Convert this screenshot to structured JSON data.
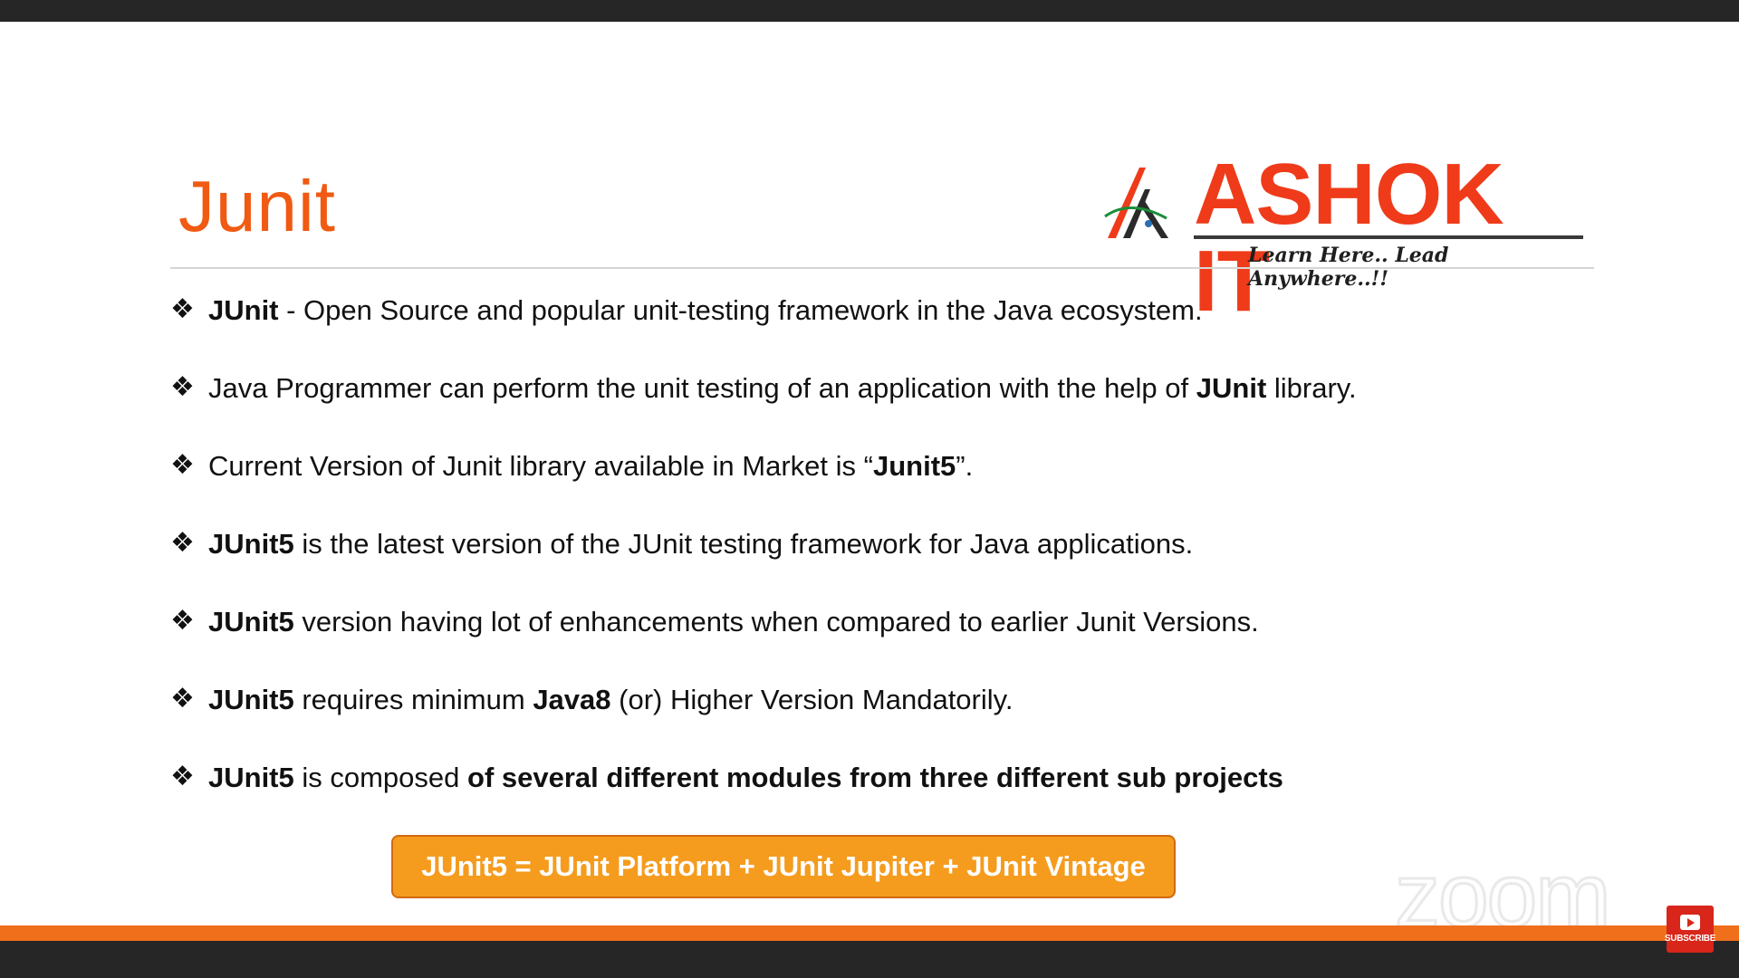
{
  "slide": {
    "title": "Junit",
    "logo": {
      "name": "ASHOK IT",
      "tagline": "Learn Here.. Lead Anywhere..!!"
    },
    "bullets": [
      {
        "bold": "JUnit",
        "text": " - Open Source and  popular unit-testing framework in the Java ecosystem.",
        "tail_bold": "",
        "tail": ""
      },
      {
        "bold": "",
        "text": "Java Programmer can perform the unit testing of an application with the help of ",
        "tail_bold": "JUnit",
        "tail": " library."
      },
      {
        "bold": "",
        "text": "Current Version of Junit library available  in Market is “",
        "tail_bold": "Junit5",
        "tail": "”."
      },
      {
        "bold": "JUnit5",
        "text": " is the latest version of the JUnit testing framework for Java applications.",
        "tail_bold": "",
        "tail": ""
      },
      {
        "bold": "JUnit5",
        "text": " version having lot of enhancements when compared to earlier Junit Versions.",
        "tail_bold": "",
        "tail": ""
      },
      {
        "bold": "JUnit5",
        "text": " requires minimum ",
        "tail_bold": "Java8",
        "tail": "  (or) Higher Version Mandatorily."
      },
      {
        "bold": "JUnit5",
        "text": " is composed ",
        "tail_bold": "of several different modules from three different sub projects",
        "tail": ""
      }
    ],
    "formula": "JUnit5 = JUnit Platform + JUnit Jupiter + JUnit Vintage"
  },
  "overlay": {
    "zoom_watermark": "zoom",
    "subscribe_label": "SUBSCRIBE"
  },
  "colors": {
    "title": "#f05a12",
    "logo": "#ef3b1a",
    "formula_bg": "#f59c1e",
    "footer_band": "#f06f1b",
    "subscribe_bg": "#d8261a"
  },
  "icons": {
    "bullet": "diamond-bullet-icon",
    "logo_mark": "ashok-it-logo-icon",
    "subscribe": "youtube-play-icon"
  }
}
